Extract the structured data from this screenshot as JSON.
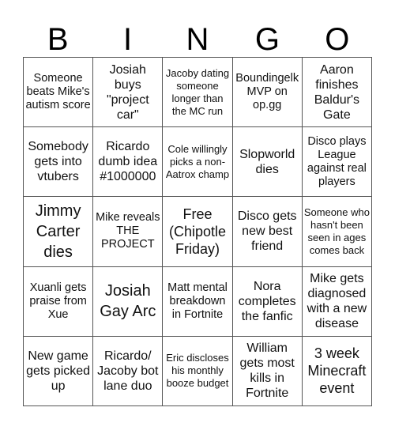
{
  "header": [
    "B",
    "I",
    "N",
    "G",
    "O"
  ],
  "cells": [
    {
      "text": "Someone beats Mike's autism score",
      "size": "s14"
    },
    {
      "text": "Josiah buys \"project car\"",
      "size": "s16"
    },
    {
      "text": "Jacoby dating someone longer than the MC run",
      "size": "s13"
    },
    {
      "text": "Boundingelk MVP on op.gg",
      "size": "s14"
    },
    {
      "text": "Aaron finishes Baldur's Gate",
      "size": "s16"
    },
    {
      "text": "Somebody gets into vtubers",
      "size": "s16"
    },
    {
      "text": "Ricardo dumb idea #1000000",
      "size": "s16"
    },
    {
      "text": "Cole willingly picks a non-Aatrox champ",
      "size": "s13"
    },
    {
      "text": "Slopworld dies",
      "size": "s16"
    },
    {
      "text": "Disco plays League against real players",
      "size": "s14"
    },
    {
      "text": "Jimmy Carter dies",
      "size": "s20"
    },
    {
      "text": "Mike reveals THE PROJECT",
      "size": "s14"
    },
    {
      "text": "Free (Chipotle Friday)",
      "size": "s18"
    },
    {
      "text": "Disco gets new best friend",
      "size": "s16"
    },
    {
      "text": "Someone who hasn't been seen in ages comes back",
      "size": "s13"
    },
    {
      "text": "Xuanli gets praise from Xue",
      "size": "s14"
    },
    {
      "text": "Josiah Gay Arc",
      "size": "s20"
    },
    {
      "text": "Matt mental breakdown in Fortnite",
      "size": "s14"
    },
    {
      "text": "Nora completes the fanfic",
      "size": "s16"
    },
    {
      "text": "Mike gets diagnosed with a new disease",
      "size": "s16"
    },
    {
      "text": "New game gets picked up",
      "size": "s16"
    },
    {
      "text": "Ricardo/ Jacoby bot lane duo",
      "size": "s16"
    },
    {
      "text": "Eric discloses his monthly booze budget",
      "size": "s13"
    },
    {
      "text": "William gets most kills in Fortnite",
      "size": "s16"
    },
    {
      "text": "3 week Minecraft event",
      "size": "s18"
    }
  ]
}
